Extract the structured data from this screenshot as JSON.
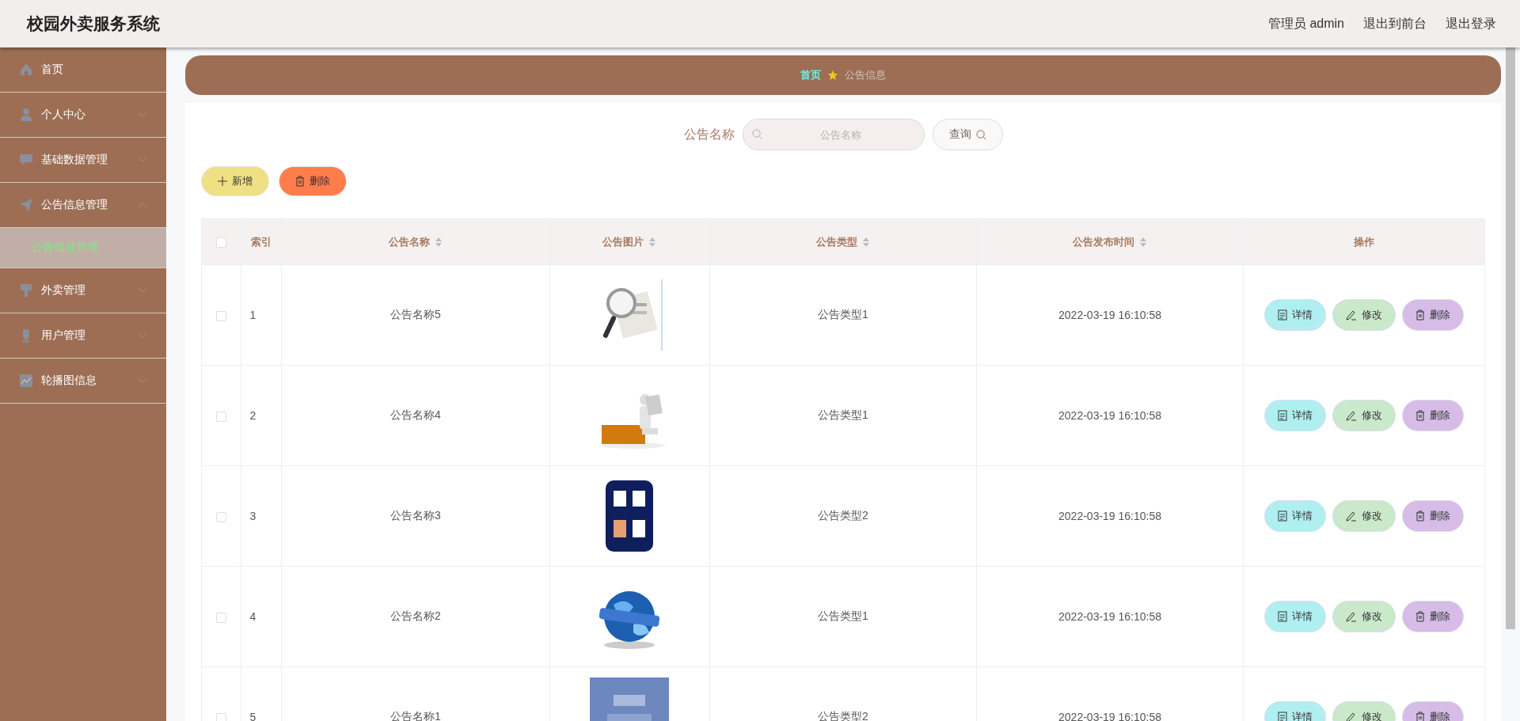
{
  "header": {
    "title": "校园外卖服务系统",
    "links": [
      "管理员 admin",
      "退出到前台",
      "退出登录"
    ]
  },
  "sidebar": {
    "items": [
      {
        "label": "首页",
        "kind": "link"
      },
      {
        "label": "个人中心",
        "kind": "group",
        "expanded": false
      },
      {
        "label": "基础数据管理",
        "kind": "group",
        "expanded": false
      },
      {
        "label": "公告信息管理",
        "kind": "group",
        "expanded": true,
        "children": [
          {
            "label": "公告信息管理",
            "selected": true
          }
        ]
      },
      {
        "label": "外卖管理",
        "kind": "group",
        "expanded": false
      },
      {
        "label": "用户管理",
        "kind": "group",
        "expanded": false
      },
      {
        "label": "轮播图信息",
        "kind": "group",
        "expanded": false
      }
    ]
  },
  "breadcrumb": [
    "首页",
    "公告信息"
  ],
  "search": {
    "label": "公告名称",
    "placeholder": "公告名称",
    "button": "查询"
  },
  "toolbar": [
    {
      "label": "新增",
      "kind": "add"
    },
    {
      "label": "删除",
      "kind": "delete"
    }
  ],
  "table": {
    "select_all": {
      "checked": false
    },
    "columns": [
      {
        "label": "索引",
        "sortable": false
      },
      {
        "label": "公告名称",
        "sortable": true
      },
      {
        "label": "公告图片",
        "sortable": true
      },
      {
        "label": "公告类型",
        "sortable": true
      },
      {
        "label": "公告发布时间",
        "sortable": true
      },
      {
        "label": "操作",
        "sortable": false
      }
    ],
    "rows": [
      {
        "checked": false,
        "index": "1",
        "name": "公告名称5",
        "type": "公告类型1",
        "time": "2022-03-19 16:10:58",
        "actions": [
          {
            "label": "详情",
            "kind": "detail"
          },
          {
            "label": "修改",
            "kind": "edit"
          },
          {
            "label": "删除",
            "kind": "delete"
          }
        ]
      },
      {
        "checked": false,
        "index": "2",
        "name": "公告名称4",
        "type": "公告类型1",
        "time": "2022-03-19 16:10:58",
        "actions": [
          {
            "label": "详情",
            "kind": "detail"
          },
          {
            "label": "修改",
            "kind": "edit"
          },
          {
            "label": "删除",
            "kind": "delete"
          }
        ]
      },
      {
        "checked": false,
        "index": "3",
        "name": "公告名称3",
        "type": "公告类型2",
        "time": "2022-03-19 16:10:58",
        "actions": [
          {
            "label": "详情",
            "kind": "detail"
          },
          {
            "label": "修改",
            "kind": "edit"
          },
          {
            "label": "删除",
            "kind": "delete"
          }
        ]
      },
      {
        "checked": false,
        "index": "4",
        "name": "公告名称2",
        "type": "公告类型1",
        "time": "2022-03-19 16:10:58",
        "actions": [
          {
            "label": "详情",
            "kind": "detail"
          },
          {
            "label": "修改",
            "kind": "edit"
          },
          {
            "label": "删除",
            "kind": "delete"
          }
        ]
      },
      {
        "checked": false,
        "index": "5",
        "name": "公告名称1",
        "type": "公告类型2",
        "time": "2022-03-19 16:10:58",
        "actions": [
          {
            "label": "详情",
            "kind": "detail"
          },
          {
            "label": "修改",
            "kind": "edit"
          },
          {
            "label": "删除",
            "kind": "delete"
          }
        ]
      }
    ]
  }
}
